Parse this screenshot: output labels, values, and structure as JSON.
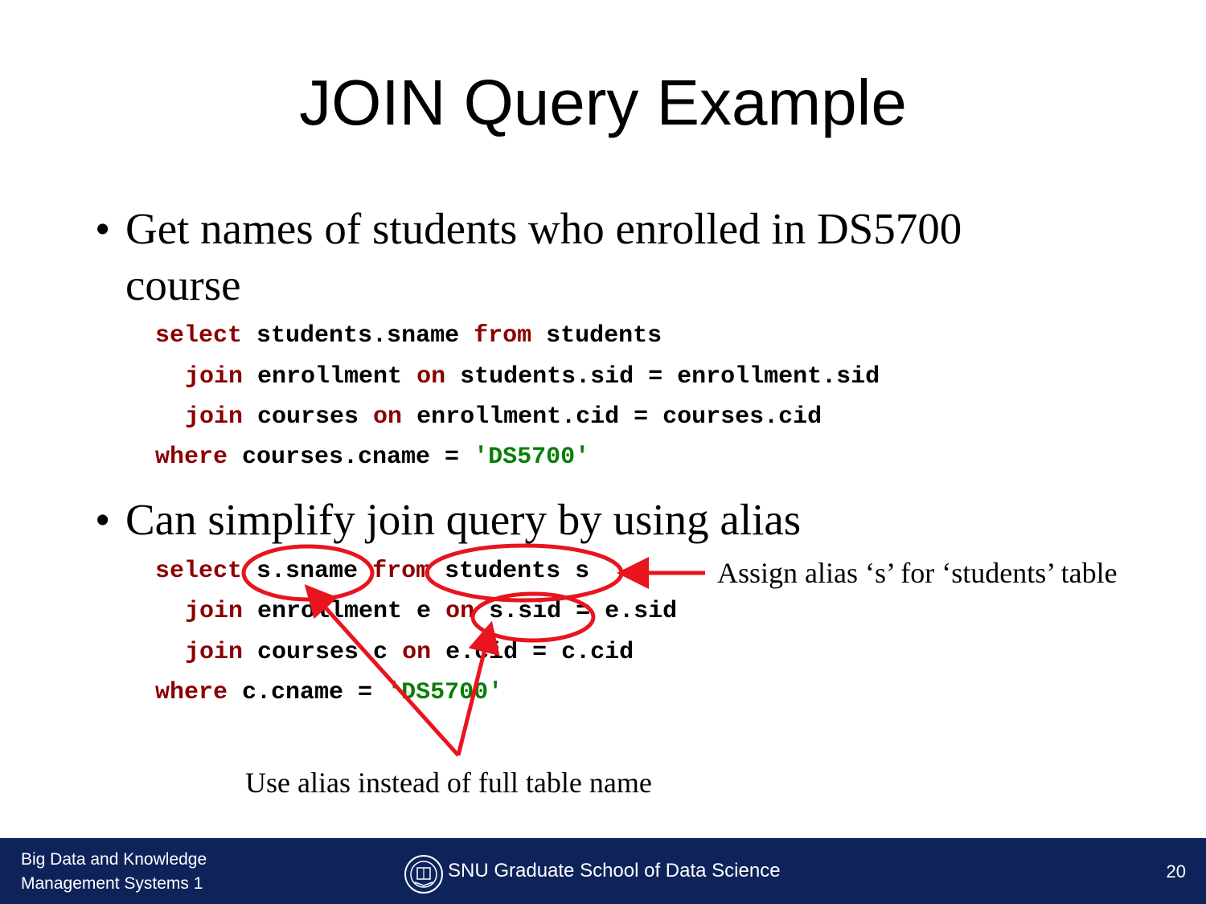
{
  "title": "JOIN Query Example",
  "bullets": [
    {
      "marker": "•",
      "line1": "Get names of students who enrolled in DS5700",
      "line2": "course"
    },
    {
      "marker": "•",
      "line1": "Can simplify join query by using alias"
    }
  ],
  "query1": {
    "l1": {
      "kw1": "select",
      "t1": " students.sname ",
      "kw2": "from",
      "t2": " students"
    },
    "l2": {
      "kw1": "join",
      "t1": " enrollment ",
      "kw2": "on",
      "t2": " students.sid = enrollment.sid"
    },
    "l3": {
      "kw1": "join",
      "t1": " courses ",
      "kw2": "on",
      "t2": " enrollment.cid = courses.cid"
    },
    "l4": {
      "kw1": "where",
      "t1": " courses.cname = ",
      "str": "'DS5700'"
    }
  },
  "query2": {
    "l1": {
      "kw1": "select",
      "t1": " s.sname ",
      "kw2": "from",
      "t2": " students s"
    },
    "l2": {
      "kw1": "join",
      "t1": " enrollment e ",
      "kw2": "on",
      "t2": " s.sid = e.sid"
    },
    "l3": {
      "kw1": "join",
      "t1": " courses c ",
      "kw2": "on",
      "t2": " e.cid = c.cid"
    },
    "l4": {
      "kw1": "where",
      "t1": " c.cname = ",
      "str": "'DS5700'"
    }
  },
  "annotations": {
    "assign_alias": "Assign alias ‘s’ for ‘students’ table",
    "use_alias": "Use alias instead of full table name"
  },
  "footer": {
    "course_line1": "Big Data and Knowledge",
    "course_line2": "Management Systems 1",
    "school": "SNU Graduate School of Data Science",
    "page_number": "20"
  },
  "colors": {
    "keyword": "#8b0000",
    "string": "#0a7d0a",
    "annotation": "#e8141e",
    "footer_bg": "#0e235a"
  }
}
